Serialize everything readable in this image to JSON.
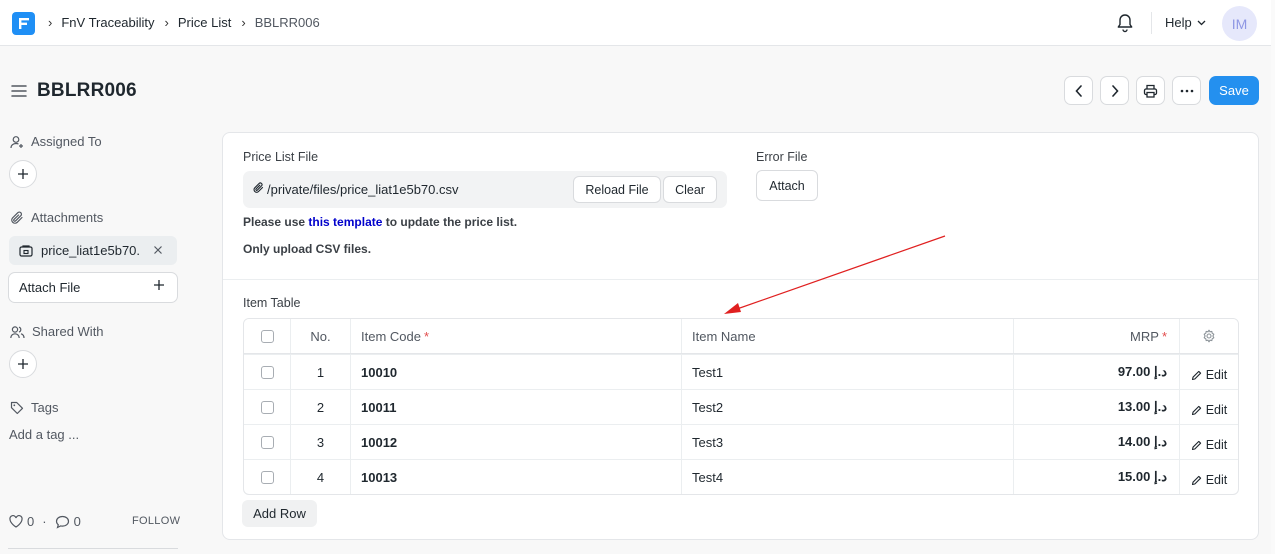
{
  "navbar": {
    "logo_icon": "frappe-logo",
    "breadcrumbs": [
      "FnV Traceability",
      "Price List",
      "BBLRR006"
    ],
    "notifications_icon": "bell-icon",
    "help_label": "Help",
    "avatar_initials": "IM"
  },
  "page": {
    "title": "BBLRR006",
    "actions": {
      "prev_icon": "chevron-left-icon",
      "next_icon": "chevron-right-icon",
      "print_icon": "printer-icon",
      "more_icon": "ellipsis-icon",
      "save_label": "Save"
    }
  },
  "sidebar": {
    "assigned_to_label": "Assigned To",
    "attachments_label": "Attachments",
    "attachment_name": "price_liat1e5b70.",
    "attach_file_label": "Attach File",
    "shared_with_label": "Shared With",
    "tags_label": "Tags",
    "add_tag_label": "Add a tag ...",
    "likes_count": "0",
    "comments_count": "0",
    "dot_separator": "·",
    "follow_label": "FOLLOW"
  },
  "form": {
    "price_list_file_label": "Price List File",
    "price_list_file_value": "/private/files/price_liat1e5b70.csv",
    "reload_file_label": "Reload File",
    "clear_label": "Clear",
    "error_file_label": "Error File",
    "attach_label": "Attach",
    "help_prefix": "Please use ",
    "help_link": "this template",
    "help_suffix": " to update the price list.",
    "csv_note": "Only upload CSV files."
  },
  "item_table": {
    "label": "Item Table",
    "columns": {
      "no": "No.",
      "item_code": "Item Code",
      "item_name": "Item Name",
      "mrp": "MRP",
      "required_marker": "*"
    },
    "rows": [
      {
        "no": "1",
        "item_code": "10010",
        "item_name": "Test1",
        "mrp": "د.إ 97.00",
        "edit": "Edit"
      },
      {
        "no": "2",
        "item_code": "10011",
        "item_name": "Test2",
        "mrp": "د.إ 13.00",
        "edit": "Edit"
      },
      {
        "no": "3",
        "item_code": "10012",
        "item_name": "Test3",
        "mrp": "د.إ 14.00",
        "edit": "Edit"
      },
      {
        "no": "4",
        "item_code": "10013",
        "item_name": "Test4",
        "mrp": "د.إ 15.00",
        "edit": "Edit"
      }
    ],
    "add_row_label": "Add Row"
  },
  "annotation": {
    "arrow_color": "#e02020"
  },
  "colors": {
    "primary": "#2490ef",
    "required": "#e24c4c",
    "link": "#0000cc"
  }
}
